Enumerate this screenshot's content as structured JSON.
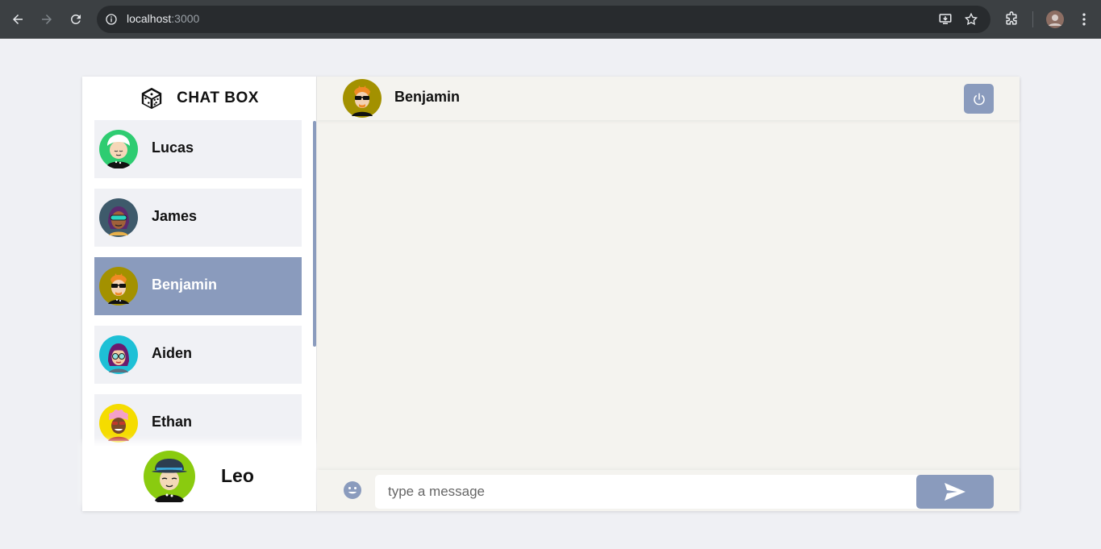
{
  "browser": {
    "url_host": "localhost",
    "url_port": ":3000",
    "icons": [
      "back-icon",
      "forward-icon",
      "reload-icon",
      "info-icon",
      "install-icon",
      "star-icon",
      "extensions-icon",
      "profile-avatar",
      "menu-icon"
    ]
  },
  "sidebar": {
    "brand_title": "CHAT BOX",
    "contacts": [
      {
        "name": "Lucas",
        "selected": false,
        "avatar_bg": "#2ecc71"
      },
      {
        "name": "James",
        "selected": false,
        "avatar_bg": "#3e5a6b"
      },
      {
        "name": "Benjamin",
        "selected": true,
        "avatar_bg": "#a39100"
      },
      {
        "name": "Aiden",
        "selected": false,
        "avatar_bg": "#1ec0d6"
      },
      {
        "name": "Ethan",
        "selected": false,
        "avatar_bg": "#f5dc00"
      }
    ],
    "current_user": {
      "name": "Leo",
      "avatar_bg": "#8acb0f"
    }
  },
  "chat": {
    "header_name": "Benjamin",
    "input_placeholder": "type a message",
    "input_value": ""
  },
  "colors": {
    "accent": "#8a9bbd",
    "chat_bg": "#f4f3ef",
    "page_bg": "#eff0f4",
    "contact_bg": "#f0f1f5"
  }
}
